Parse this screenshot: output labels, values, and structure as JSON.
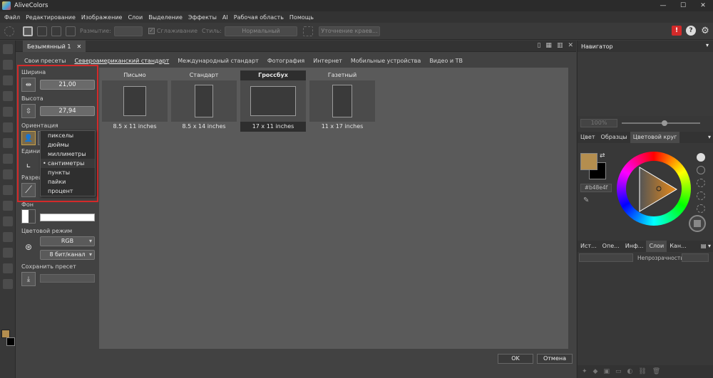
{
  "window": {
    "title": "AliveColors",
    "min": "—",
    "max": "☐",
    "close": "✕"
  },
  "menu": [
    "Файл",
    "Редактирование",
    "Изображение",
    "Слои",
    "Выделение",
    "Эффекты",
    "AI",
    "Рабочая область",
    "Помощь"
  ],
  "toolbar": {
    "blur_label": "Размытие:",
    "smoothing_label": "Сглаживание",
    "style_label": "Стиль:",
    "style_value": "Нормальный",
    "refine_button": "Уточнение краев...",
    "help_icon": "?",
    "alert_icon": "!",
    "settings_icon": "⚙"
  },
  "document": {
    "tab_title": "Безымянный 1",
    "close": "✕"
  },
  "preset_tabs": [
    {
      "label": "Свои пресеты",
      "active": false
    },
    {
      "label": "Североамериканский стандарт",
      "active": true
    },
    {
      "label": "Международный стандарт",
      "active": false
    },
    {
      "label": "Фотография",
      "active": false
    },
    {
      "label": "Интернет",
      "active": false
    },
    {
      "label": "Мобильные устройства",
      "active": false
    },
    {
      "label": "Видео и ТВ",
      "active": false
    }
  ],
  "form": {
    "width_label": "Ширина",
    "width_value": "21,00",
    "height_label": "Высота",
    "height_value": "27,94",
    "orientation_label": "Ориентация",
    "units_label": "Единиц",
    "resolution_label": "Разреш",
    "background_label": "Фон",
    "color_mode_label": "Цветовой режим",
    "color_mode_value": "RGB",
    "bit_depth_value": "8 бит/канал",
    "save_preset_label": "Сохранить пресет"
  },
  "units_dropdown": {
    "options": [
      "пикселы",
      "дюймы",
      "миллиметры",
      "сантиметры",
      "пункты",
      "пайки",
      "процент"
    ],
    "selected": "сантиметры"
  },
  "presets": [
    {
      "name": "Письмо",
      "size": "8.5 x 11 inches",
      "selected": false
    },
    {
      "name": "Стандарт",
      "size": "8.5 x 14 inches",
      "selected": false
    },
    {
      "name": "Гроссбух",
      "size": "17 x 11 inches",
      "selected": true
    },
    {
      "name": "Газетный",
      "size": "11 x 17 inches",
      "selected": false
    }
  ],
  "buttons": {
    "ok": "OK",
    "cancel": "Отмена"
  },
  "navigator": {
    "title": "Навигатор",
    "zoom": "100%"
  },
  "color_panel": {
    "tabs": [
      {
        "label": "Цвет",
        "active": false
      },
      {
        "label": "Образцы",
        "active": false
      },
      {
        "label": "Цветовой круг",
        "active": true
      }
    ],
    "hex": "#b48e4f",
    "fg_color": "#b48e4f",
    "bg_color": "#000000"
  },
  "layers_panel": {
    "tabs": [
      {
        "label": "Ист...",
        "active": false
      },
      {
        "label": "Опе...",
        "active": false
      },
      {
        "label": "Инф...",
        "active": false
      },
      {
        "label": "Слои",
        "active": true
      },
      {
        "label": "Кан...",
        "active": false
      }
    ],
    "opacity_label": "Непрозрачность"
  }
}
